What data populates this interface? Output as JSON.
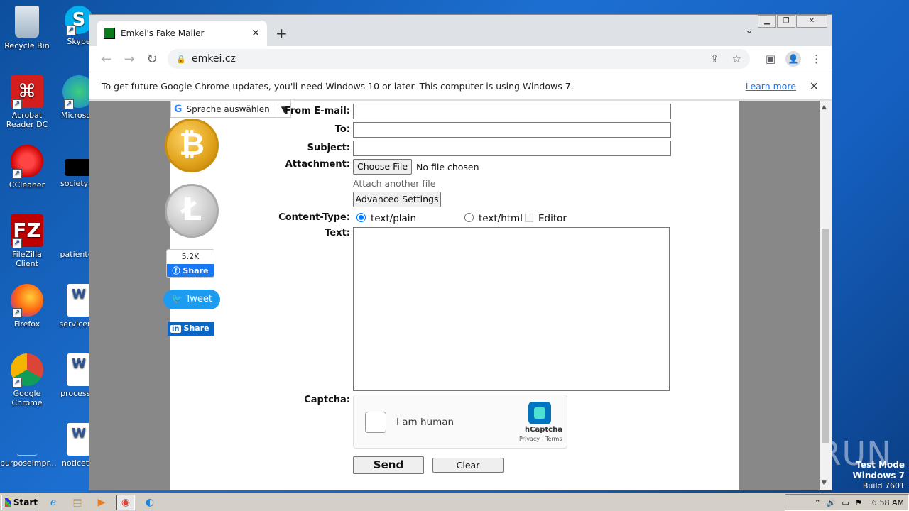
{
  "desktop": {
    "icons": [
      {
        "label": "Recycle Bin"
      },
      {
        "label": "Skype"
      },
      {
        "label": "Acrobat Reader DC"
      },
      {
        "label": "Microsoft"
      },
      {
        "label": "CCleaner"
      },
      {
        "label": "societyac"
      },
      {
        "label": "FileZilla Client"
      },
      {
        "label": "patientde"
      },
      {
        "label": "Firefox"
      },
      {
        "label": "servicerat"
      },
      {
        "label": "Google Chrome"
      },
      {
        "label": "processvi"
      },
      {
        "label": "purposeimpr..."
      },
      {
        "label": "noticethi"
      }
    ],
    "watermark": {
      "line1": "Test Mode",
      "line2": "Windows 7",
      "line3": "Build 7601"
    },
    "anyrun": "ANY RUN"
  },
  "browser": {
    "tab_title": "Emkei's Fake Mailer",
    "url": "emkei.cz",
    "infobar_text": "To get future Google Chrome updates, you'll need Windows 10 or later. This computer is using Windows 7.",
    "infobar_link": "Learn more"
  },
  "page": {
    "translate_label": "Sprache auswählen",
    "fb_count": "5.2K",
    "fb_share": "Share",
    "tweet": "Tweet",
    "linkedin_share": "Share",
    "form": {
      "from_email_label": "From E-mail:",
      "to_label": "To:",
      "subject_label": "Subject:",
      "attachment_label": "Attachment:",
      "choose_file": "Choose File",
      "no_file": "No file chosen",
      "attach_another": "Attach another file",
      "advanced_settings": "Advanced Settings",
      "content_type_label": "Content-Type:",
      "opt_plain": "text/plain",
      "opt_html": "text/html",
      "opt_editor": "Editor",
      "text_label": "Text:",
      "captcha_label": "Captcha:",
      "captcha_text": "I am human",
      "captcha_brand": "hCaptcha",
      "captcha_links": "Privacy - Terms",
      "send": "Send",
      "clear": "Clear"
    }
  },
  "taskbar": {
    "start": "Start",
    "time": "6:58 AM"
  },
  "colors": {
    "accent": "#1a73e8",
    "facebook": "#1877f2",
    "twitter": "#1d9bf0",
    "linkedin": "#0a66c2"
  }
}
